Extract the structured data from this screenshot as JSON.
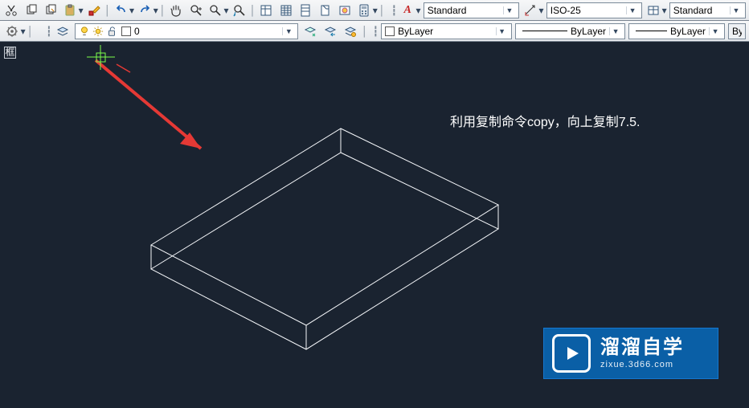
{
  "toolbar1": {
    "text_style": "Standard",
    "dim_style": "ISO-25",
    "table_style": "Standard"
  },
  "toolbar2": {
    "layer": "0",
    "color_name": "ByLayer",
    "linetype": "ByLayer",
    "lineweight": "ByLayer",
    "plot_style_short": "By"
  },
  "canvas": {
    "annotation": "利用复制命令copy，向上复制7.5.",
    "cursor_hint": "框"
  },
  "watermark": {
    "name": "溜溜自学",
    "url": "zixue.3d66.com"
  },
  "chart_data": {
    "type": "table",
    "description": "AutoCAD viewport showing a 3D rectangular slab (box wireframe) in SW isometric. A red arrow points from upper-left toward the slab. Annotation instructs to use COPY command, copy upward by 7.5 units.",
    "solid": {
      "shape": "box",
      "note": "thin rectangular slab, wireframe"
    },
    "copy_offset": 7.5,
    "copy_direction": "up (+Z)",
    "command": "copy"
  }
}
